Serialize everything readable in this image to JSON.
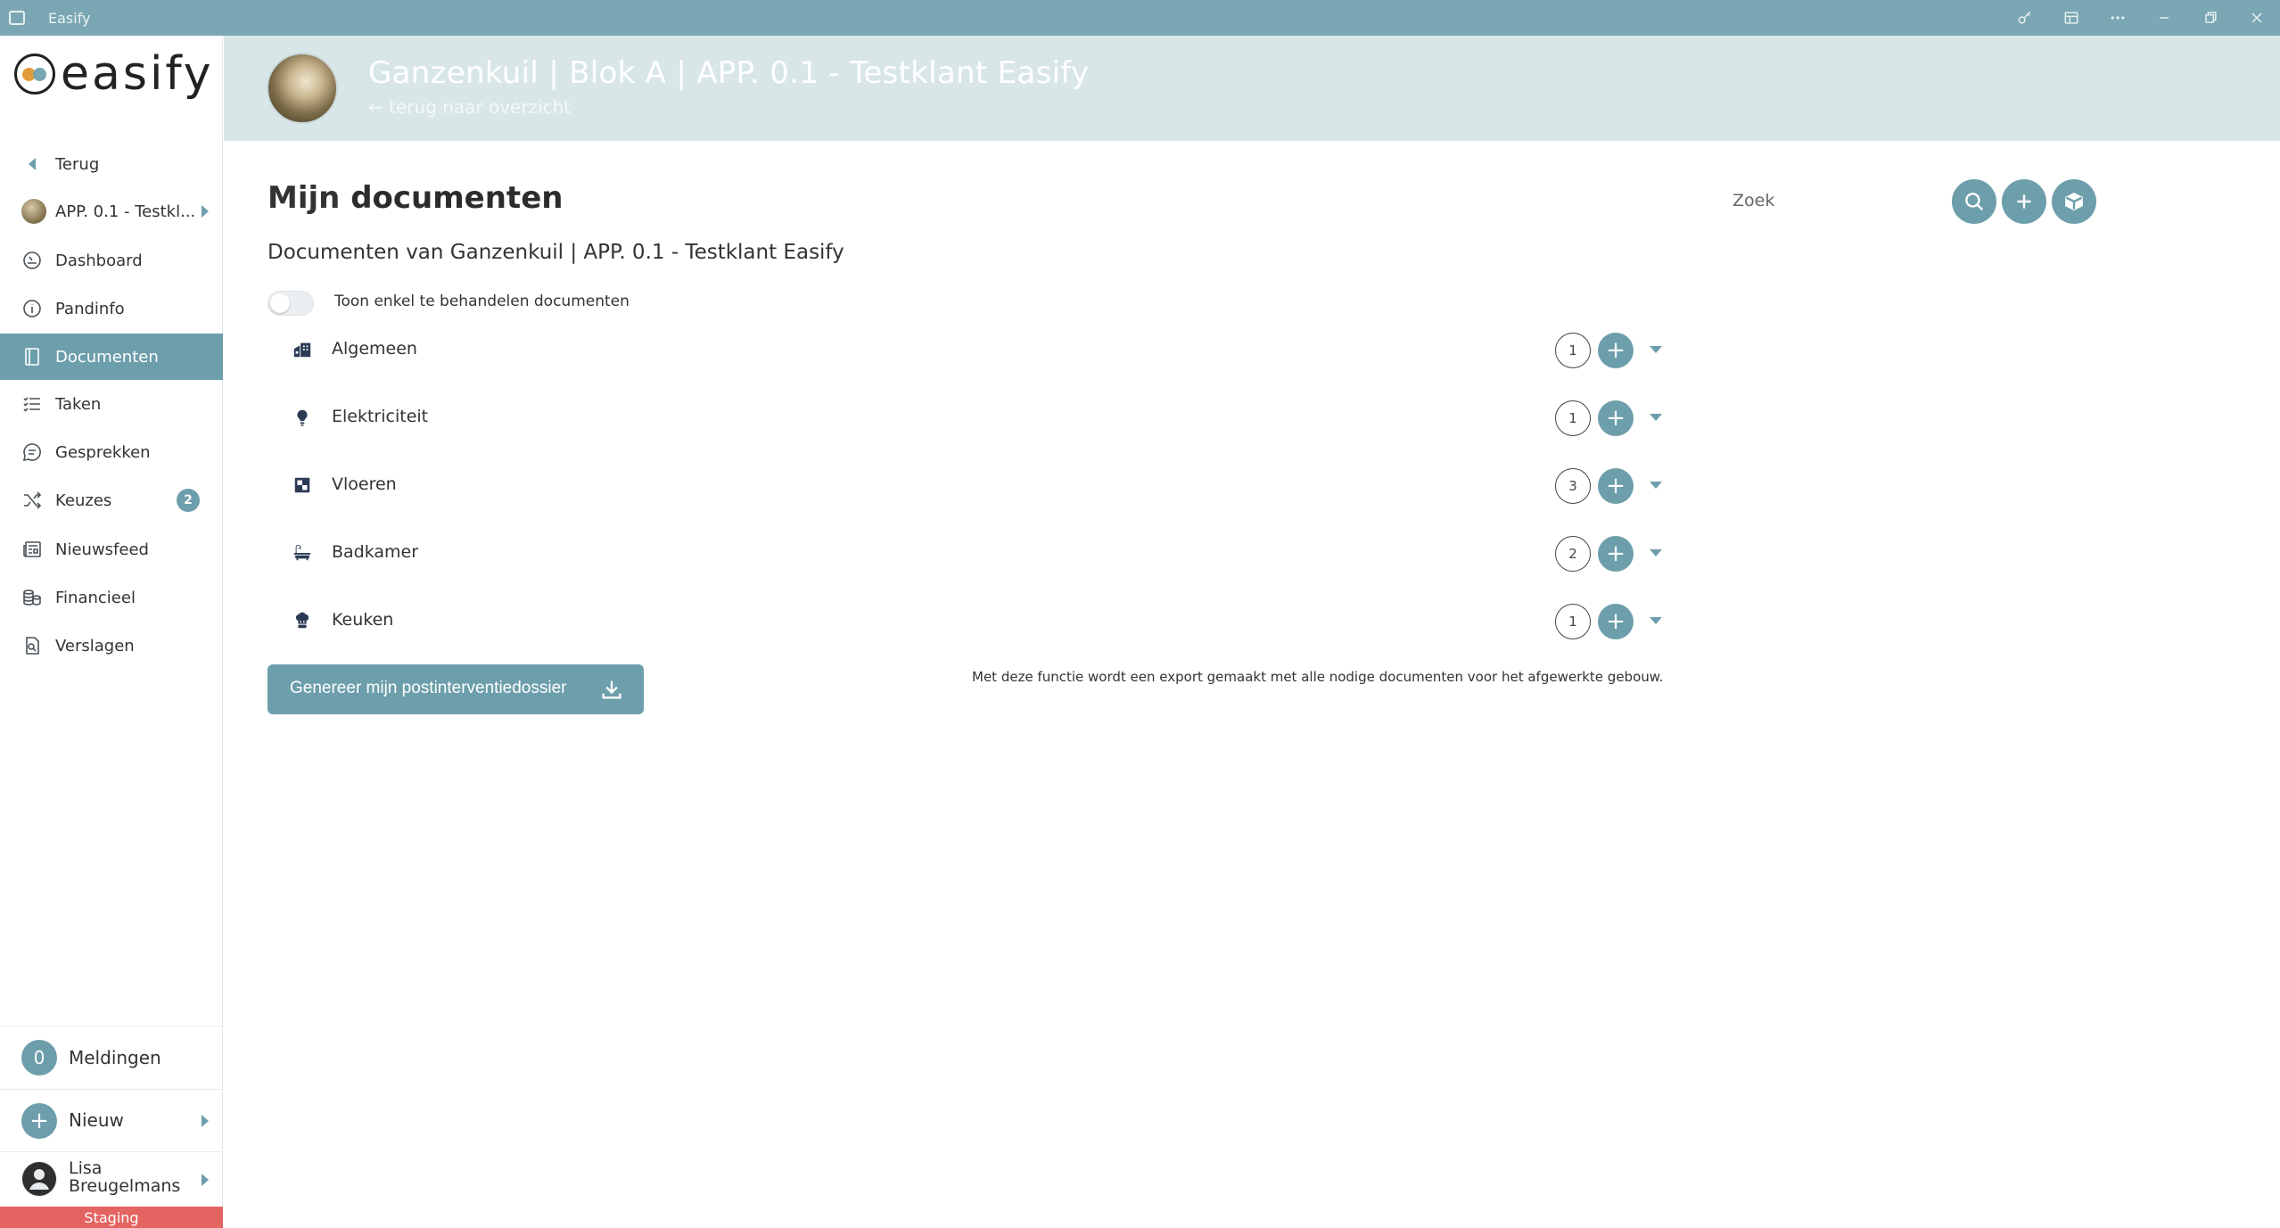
{
  "window": {
    "title": "Easify",
    "controls": [
      "key-icon",
      "panel-icon",
      "more-icon",
      "minimize-icon",
      "restore-icon",
      "close-icon"
    ]
  },
  "sidebar": {
    "logo_text": "easify",
    "back_label": "Terug",
    "project_label": "APP. 0.1 - Testkl...",
    "items": [
      {
        "label": "Dashboard",
        "icon": "dashboard-icon"
      },
      {
        "label": "Pandinfo",
        "icon": "info-icon"
      },
      {
        "label": "Documenten",
        "icon": "document-icon",
        "active": true
      },
      {
        "label": "Taken",
        "icon": "tasks-icon"
      },
      {
        "label": "Gesprekken",
        "icon": "chat-icon"
      },
      {
        "label": "Keuzes",
        "icon": "shuffle-icon",
        "badge": "2"
      },
      {
        "label": "Nieuwsfeed",
        "icon": "newspaper-icon"
      },
      {
        "label": "Financieel",
        "icon": "coins-icon"
      },
      {
        "label": "Verslagen",
        "icon": "report-icon"
      }
    ],
    "notifications": {
      "count": "0",
      "label": "Meldingen"
    },
    "new_label": "Nieuw",
    "user": {
      "first": "Lisa",
      "last": "Breugelmans"
    },
    "environment": "Staging"
  },
  "header": {
    "title": "Ganzenkuil | Blok A | APP. 0.1 - Testklant Easify",
    "back_link": "← terug naar overzicht"
  },
  "main": {
    "title_light": "Mijn ",
    "title_bold": "documenten",
    "search_placeholder": "Zoek",
    "subheading": "Documenten van Ganzenkuil | APP. 0.1 - Testklant Easify",
    "toggle_label": "Toon enkel te behandelen documenten",
    "toggle_on": false,
    "categories": [
      {
        "name": "Algemeen",
        "count": "1",
        "icon": "building-icon"
      },
      {
        "name": "Elektriciteit",
        "count": "1",
        "icon": "lightbulb-icon"
      },
      {
        "name": "Vloeren",
        "count": "3",
        "icon": "floor-tiles-icon"
      },
      {
        "name": "Badkamer",
        "count": "2",
        "icon": "bathtub-icon"
      },
      {
        "name": "Keuken",
        "count": "1",
        "icon": "chef-hat-icon"
      }
    ],
    "generate_button": "Genereer mijn postinterventiedossier",
    "generate_info": "Met deze functie wordt een export gemaakt met alle nodige documenten voor het afgewerkte gebouw."
  },
  "colors": {
    "accent": "#6d9eab",
    "titlebar": "#7aa7b3",
    "header_bg": "#d9e6e8",
    "staging": "#e46461"
  }
}
